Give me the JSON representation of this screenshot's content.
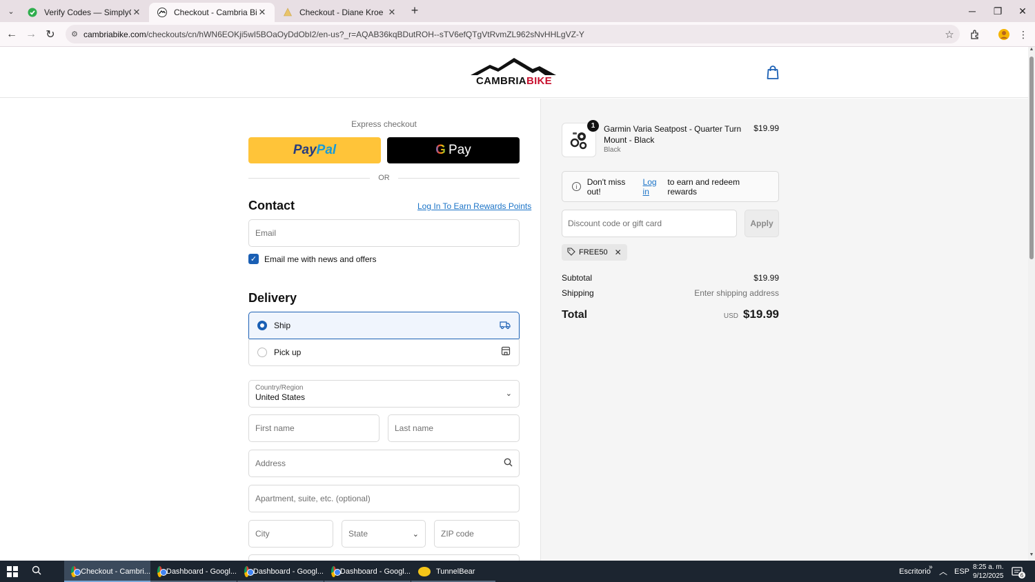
{
  "browser": {
    "tabs": [
      {
        "title": "Verify Codes — SimplyCodes",
        "favicon": "simplycodes-icon"
      },
      {
        "title": "Checkout - Cambria Bike",
        "favicon": "cambria-icon"
      },
      {
        "title": "Checkout - Diane Kroe",
        "favicon": "kroe-icon"
      }
    ],
    "url_host": "cambriabike.com",
    "url_path": "/checkouts/cn/hWN6EOKji5wI5BOaOyDdObI2/en-us?_r=AQAB36kqBDutROH--sTV6efQTgVtRvmZL962sNvHHLgVZ-Y"
  },
  "store": {
    "brand_main": "CAMBRIA",
    "brand_accent": "BIKE",
    "accent_color": "#c8102e"
  },
  "checkout": {
    "express_label": "Express checkout",
    "paypal_part1": "Pay",
    "paypal_part2": "Pal",
    "gpay_label": "Pay",
    "or_label": "OR",
    "contact_title": "Contact",
    "rewards_link": "Log In To Earn Rewards Points",
    "email_placeholder": "Email",
    "news_label": "Email me with news and offers",
    "delivery_title": "Delivery",
    "ship_label": "Ship",
    "pickup_label": "Pick up",
    "country_label": "Country/Region",
    "country_value": "United States",
    "first_name_placeholder": "First name",
    "last_name_placeholder": "Last name",
    "address_placeholder": "Address",
    "apartment_placeholder": "Apartment, suite, etc. (optional)",
    "city_placeholder": "City",
    "state_placeholder": "State",
    "zip_placeholder": "ZIP code"
  },
  "summary": {
    "quantity": "1",
    "product_name": "Garmin Varia Seatpost - Quarter Turn Mount - Black",
    "variant": "Black",
    "price": "$19.99",
    "rewards_text_before": "Don't miss out!",
    "rewards_link": "Log in",
    "rewards_text_after": "to earn and redeem rewards",
    "discount_placeholder": "Discount code or gift card",
    "apply_label": "Apply",
    "applied_code": "FREE50",
    "subtotal_label": "Subtotal",
    "subtotal_value": "$19.99",
    "shipping_label": "Shipping",
    "shipping_value": "Enter shipping address",
    "total_label": "Total",
    "currency": "USD",
    "total_value": "$19.99"
  },
  "taskbar": {
    "items": [
      {
        "label": "Checkout - Cambri..."
      },
      {
        "label": "Dashboard - Googl..."
      },
      {
        "label": "Dashboard - Googl..."
      },
      {
        "label": "Dashboard - Googl..."
      },
      {
        "label": "TunnelBear"
      }
    ],
    "desktop_label": "Escritorio",
    "language": "ESP",
    "time": "8:25 a. m.",
    "date": "9/12/2025",
    "notification_count": "6"
  }
}
